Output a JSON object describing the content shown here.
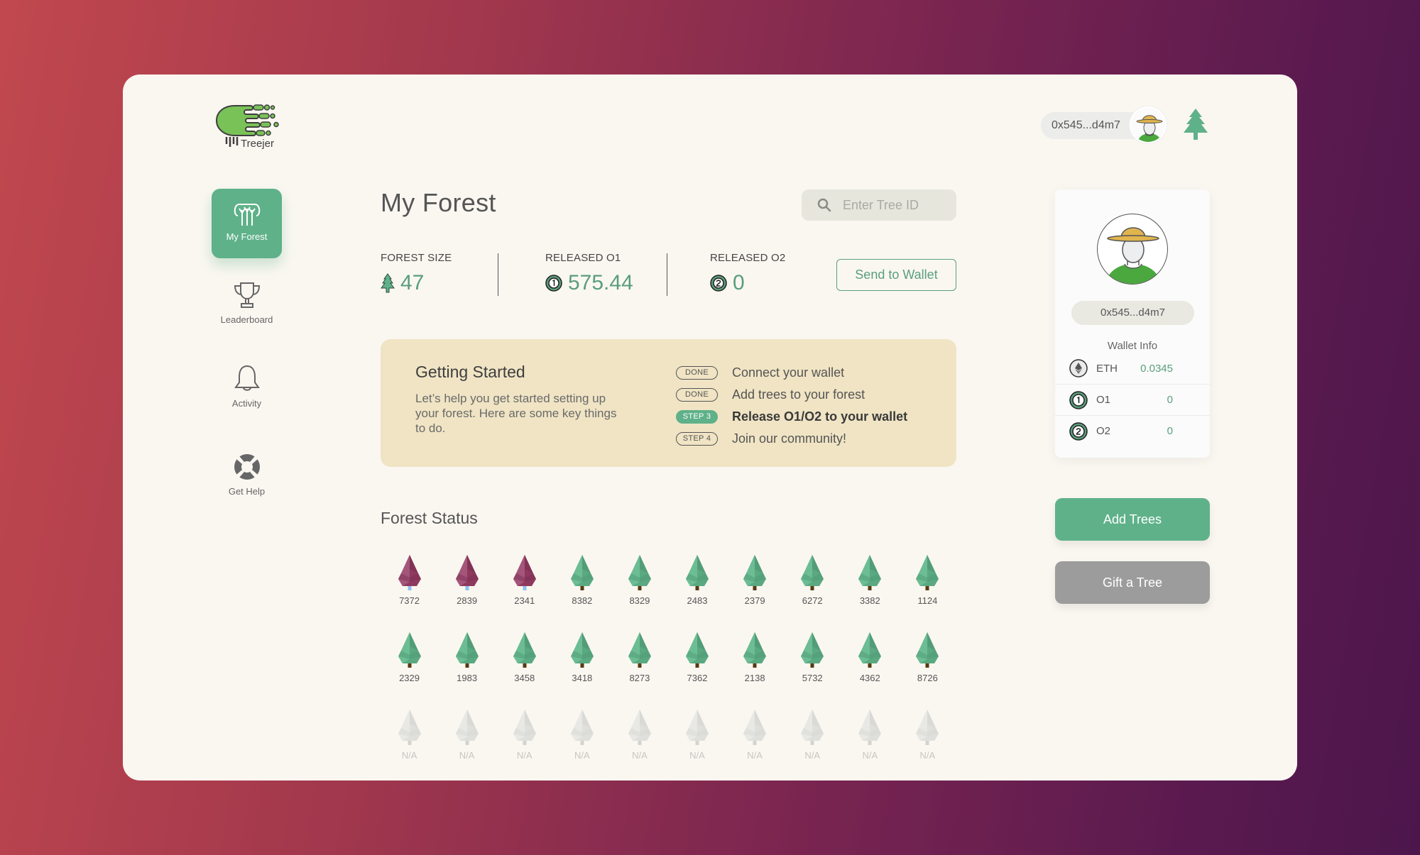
{
  "app": {
    "brand": "Treejer",
    "colors": {
      "primary": "#5fb189",
      "primary_text": "#5a9e7c",
      "panel_bg": "#faf7f1",
      "getting_started_bg": "#f0e4c4",
      "gift_button": "#9c9c9c",
      "tree_green": "#62b38b",
      "tree_maroon": "#8e3a5e",
      "tree_empty": "#e2e2de"
    }
  },
  "header": {
    "wallet_address": "0x545...d4m7",
    "avatar_icon": "farmer-avatar-icon",
    "tree_icon": "tree-icon"
  },
  "sidebar": {
    "items": [
      {
        "label": "My Forest",
        "icon": "forest-icon",
        "active": true
      },
      {
        "label": "Leaderboard",
        "icon": "trophy-icon",
        "active": false
      },
      {
        "label": "Activity",
        "icon": "bell-icon",
        "active": false
      },
      {
        "label": "Get Help",
        "icon": "lifebuoy-icon",
        "active": false
      }
    ]
  },
  "main": {
    "title": "My Forest",
    "search": {
      "placeholder": "Enter Tree ID",
      "value": ""
    },
    "stats": [
      {
        "label": "FOREST SIZE",
        "value": "47",
        "icon": "tree-icon"
      },
      {
        "label": "RELEASED O1",
        "value": "575.44",
        "icon": "o1-coin-icon"
      },
      {
        "label": "RELEASED O2",
        "value": "0",
        "icon": "o2-coin-icon"
      }
    ],
    "send_to_wallet_label": "Send to Wallet",
    "getting_started": {
      "title": "Getting Started",
      "description": "Let’s help you get started setting up your forest. Here are some key things to do.",
      "steps": [
        {
          "badge": "DONE",
          "text": "Connect your wallet",
          "state": "done"
        },
        {
          "badge": "DONE",
          "text": "Add trees to your forest",
          "state": "done"
        },
        {
          "badge": "STEP 3",
          "text": "Release O1/O2 to your wallet",
          "state": "current"
        },
        {
          "badge": "STEP 4",
          "text": "Join our community!",
          "state": "pending"
        }
      ]
    },
    "forest_status": {
      "title": "Forest Status",
      "rows": [
        [
          {
            "id": "7372",
            "status": "maroon"
          },
          {
            "id": "2839",
            "status": "maroon"
          },
          {
            "id": "2341",
            "status": "maroon"
          },
          {
            "id": "8382",
            "status": "green"
          },
          {
            "id": "8329",
            "status": "green"
          },
          {
            "id": "2483",
            "status": "green"
          },
          {
            "id": "2379",
            "status": "green"
          },
          {
            "id": "6272",
            "status": "green"
          },
          {
            "id": "3382",
            "status": "green"
          },
          {
            "id": "1124",
            "status": "green"
          }
        ],
        [
          {
            "id": "2329",
            "status": "green"
          },
          {
            "id": "1983",
            "status": "green"
          },
          {
            "id": "3458",
            "status": "green"
          },
          {
            "id": "3418",
            "status": "green"
          },
          {
            "id": "8273",
            "status": "green"
          },
          {
            "id": "7362",
            "status": "green"
          },
          {
            "id": "2138",
            "status": "green"
          },
          {
            "id": "5732",
            "status": "green"
          },
          {
            "id": "4362",
            "status": "green"
          },
          {
            "id": "8726",
            "status": "green"
          }
        ],
        [
          {
            "id": "N/A",
            "status": "empty"
          },
          {
            "id": "N/A",
            "status": "empty"
          },
          {
            "id": "N/A",
            "status": "empty"
          },
          {
            "id": "N/A",
            "status": "empty"
          },
          {
            "id": "N/A",
            "status": "empty"
          },
          {
            "id": "N/A",
            "status": "empty"
          },
          {
            "id": "N/A",
            "status": "empty"
          },
          {
            "id": "N/A",
            "status": "empty"
          },
          {
            "id": "N/A",
            "status": "empty"
          },
          {
            "id": "N/A",
            "status": "empty"
          }
        ]
      ]
    }
  },
  "wallet_panel": {
    "address": "0x545...d4m7",
    "info_label": "Wallet Info",
    "balances": [
      {
        "symbol": "ETH",
        "amount": "0.0345",
        "icon": "ethereum-icon"
      },
      {
        "symbol": "O1",
        "amount": "0",
        "icon": "o1-coin-icon"
      },
      {
        "symbol": "O2",
        "amount": "0",
        "icon": "o2-coin-icon"
      }
    ]
  },
  "actions": {
    "add_trees_label": "Add Trees",
    "gift_tree_label": "Gift a Tree"
  }
}
